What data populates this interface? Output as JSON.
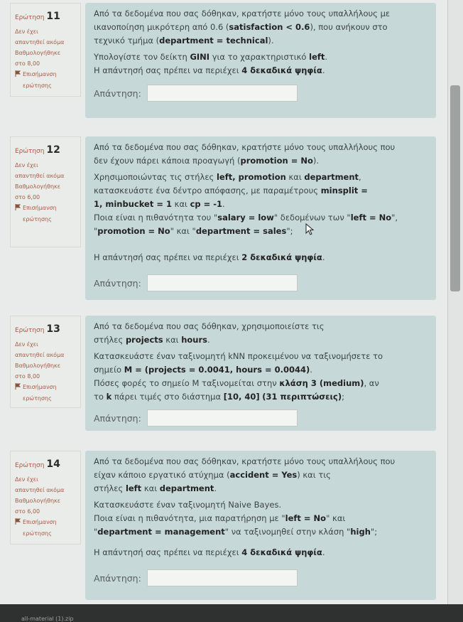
{
  "questions": [
    {
      "number_prefix": "Ερώτηση",
      "number": "11",
      "status": [
        "Δεν έχει",
        "απαντηθεί ακόμα"
      ],
      "grade": [
        "Βαθμολογήθηκε",
        "στο 8,00"
      ],
      "flag_label": [
        "Επισήμανση",
        "ερώτησης"
      ],
      "lines": [
        [
          "Από τα δεδομένα που σας δόθηκαν, κρατήστε μόνο τους υπαλλήλους με",
          "ικανοποίηση μικρότερη από 0.6 (",
          "satisfaction < 0.6",
          "), που ανήκουν στο",
          "τεχνικό τμήμα (",
          "department = technical",
          ")."
        ],
        [
          "Υπολογίστε τον δείκτη ",
          "GINI",
          " για το χαρακτηριστικό ",
          "left",
          "."
        ],
        [
          "Η απάντησή σας πρέπει να περιέχει ",
          "4 δεκαδικά ψηφία",
          "."
        ]
      ],
      "answer_label": "Απάντηση:"
    },
    {
      "number_prefix": "Ερώτηση",
      "number": "12",
      "status": [
        "Δεν έχει",
        "απαντηθεί ακόμα"
      ],
      "grade": [
        "Βαθμολογήθηκε",
        "στο 6,00"
      ],
      "flag_label": [
        "Επισήμανση",
        "ερώτησης"
      ],
      "lines": [
        [
          "Από τα δεδομένα που σας δόθηκαν, κρατήστε μόνο τους υπαλλήλους που",
          "δεν έχουν πάρει κάποια προαγωγή (",
          "promotion = No",
          ")."
        ],
        [
          "Χρησιμοποιώντας τις στήλες ",
          "left, promotion",
          " και ",
          "department",
          ",",
          "κατασκευάστε ένα δέντρο απόφασης, με παραμέτρους ",
          "minsplit =",
          "1, minbucket = 1",
          " και ",
          "cp = -1",
          "."
        ],
        [
          "Ποια είναι η πιθανότητα του \"",
          "salary = low",
          "\" δεδομένων των \"",
          "left = No",
          "\",",
          "\"",
          "promotion = No",
          "\" και \"",
          "department = sales",
          "\";"
        ],
        [
          "Η απάντησή σας πρέπει να περιέχει ",
          "2 δεκαδικά ψηφία",
          "."
        ]
      ],
      "answer_label": "Απάντηση:"
    },
    {
      "number_prefix": "Ερώτηση",
      "number": "13",
      "status": [
        "Δεν έχει",
        "απαντηθεί ακόμα"
      ],
      "grade": [
        "Βαθμολογήθηκε",
        "στο 8,00"
      ],
      "flag_label": [
        "Επισήμανση",
        "ερώτησης"
      ],
      "lines": [
        [
          "Από τα δεδομένα που σας δόθηκαν, χρησιμοποιείστε τις",
          "στήλες ",
          "projects",
          " και ",
          "hours",
          "."
        ],
        [
          "Κατασκευάστε έναν ταξινομητή kNN προκειμένου να ταξινομήσετε το",
          "σημείο ",
          "M = (projects = 0.0041, hours = 0.0044)",
          "."
        ],
        [
          "Πόσες φορές το σημείο Μ ταξινομείται στην ",
          "κλάση 3 (medium)",
          ", αν",
          "το ",
          "k",
          " πάρει τιμές στο διάστημα ",
          "[10, 40]",
          " ",
          "(31 περιπτώσεις)",
          ";"
        ]
      ],
      "answer_label": "Απάντηση:"
    },
    {
      "number_prefix": "Ερώτηση",
      "number": "14",
      "status": [
        "Δεν έχει",
        "απαντηθεί ακόμα"
      ],
      "grade": [
        "Βαθμολογήθηκε",
        "στο 6,00"
      ],
      "flag_label": [
        "Επισήμανση",
        "ερώτησης"
      ],
      "lines": [
        [
          "Από τα δεδομένα που σας δόθηκαν, κρατήστε μόνο τους υπαλλήλους που",
          "είχαν κάποιο εργατικό ατύχημα (",
          "accident = Yes",
          ") και τις",
          "στήλες ",
          "left",
          " και ",
          "department",
          "."
        ],
        [
          "Κατασκευάστε έναν ταξινομητή Naive Bayes."
        ],
        [
          "Ποια είναι η πιθανότητα, μια παρατήρηση με \"",
          "left = No",
          "\" και",
          "\"",
          "department = management",
          "\" να ταξινομηθεί στην κλάση \"",
          "high",
          "\";"
        ],
        [
          "Η απάντησή σας πρέπει να περιέχει ",
          "4 δεκαδικά ψηφία",
          "."
        ]
      ],
      "answer_label": "Απάντηση:"
    }
  ],
  "footer": {
    "text": "all-material (1).zip"
  },
  "colors": {
    "content_bg": "#c7d8d9",
    "label_red": "#a55c48",
    "text": "#3a4442"
  }
}
